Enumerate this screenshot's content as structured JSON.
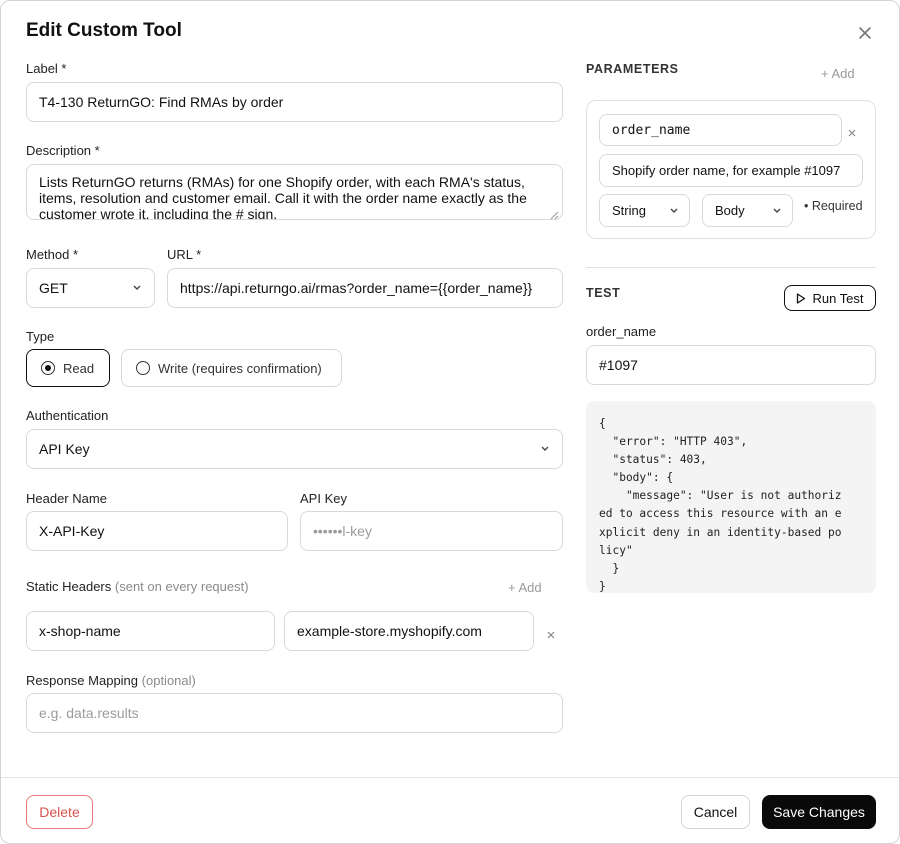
{
  "dialog": {
    "title": "Edit Custom Tool"
  },
  "form": {
    "label_label": "Label *",
    "label_value": "T4-130 ReturnGO: Find RMAs by order",
    "description_label": "Description *",
    "description_value": "Lists ReturnGO returns (RMAs) for one Shopify order, with each RMA's status, items, resolution and customer email. Call it with the order name exactly as the customer wrote it, including the # sign.",
    "method_label": "Method *",
    "method_value": "GET",
    "url_label": "URL *",
    "url_value": "https://api.returngo.ai/rmas?order_name={{order_name}}",
    "type_label": "Type",
    "type_options": [
      {
        "label": "Read",
        "selected": true
      },
      {
        "label": "Write (requires confirmation)",
        "selected": false
      }
    ],
    "auth_label": "Authentication",
    "auth_value": "API Key",
    "header_name_label": "Header Name",
    "header_name_value": "X-API-Key",
    "api_key_label": "API Key",
    "api_key_placeholder": "••••••l-key",
    "static_headers_label": "Static Headers",
    "static_headers_hint": "(sent on every request)",
    "static_headers_add": "+ Add",
    "static_header_key": "x-shop-name",
    "static_header_value": "example-store.myshopify.com",
    "response_mapping_label": "Response Mapping",
    "response_mapping_hint": "(optional)",
    "response_mapping_placeholder": "e.g. data.results"
  },
  "parameters": {
    "heading": "PARAMETERS",
    "add_label": "+ Add",
    "name": "order_name",
    "description": "Shopify order name, for example #1097",
    "type": "String",
    "location": "Body",
    "required_label": "• Required"
  },
  "test": {
    "heading": "TEST",
    "run_label": "Run Test",
    "param_label": "order_name",
    "param_value": "#1097",
    "output": "{\n  \"error\": \"HTTP 403\",\n  \"status\": 403,\n  \"body\": {\n    \"message\": \"User is not authoriz\ned to access this resource with an e\nxplicit deny in an identity-based po\nlicy\"\n  }\n}"
  },
  "footer": {
    "delete_label": "Delete",
    "cancel_label": "Cancel",
    "save_label": "Save Changes"
  },
  "colors": {
    "danger": "#d9534f",
    "primary": "#0a0a0a",
    "border": "#d9d9d9"
  }
}
